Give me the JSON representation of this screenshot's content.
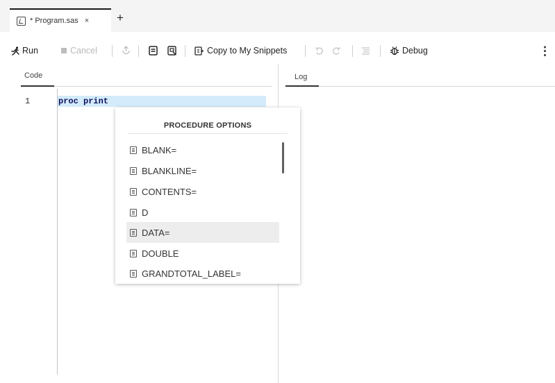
{
  "tabs": [
    {
      "label": "* Program.sas",
      "close": "×"
    }
  ],
  "add_tab": "+",
  "toolbar": {
    "run": "Run",
    "cancel": "Cancel",
    "copy_snippets": "Copy to My Snippets",
    "debug": "Debug",
    "more": "⋮"
  },
  "code_panel": {
    "label": "Code"
  },
  "log_panel": {
    "label": "Log"
  },
  "editor": {
    "lines": [
      {
        "number": "1",
        "text": "proc print"
      }
    ]
  },
  "autocomplete": {
    "header": "PROCEDURE OPTIONS",
    "items": [
      {
        "label": "BLANK="
      },
      {
        "label": "BLANKLINE="
      },
      {
        "label": "CONTENTS="
      },
      {
        "label": "D"
      },
      {
        "label": "DATA=",
        "highlighted": true
      },
      {
        "label": "DOUBLE"
      },
      {
        "label": "GRANDTOTAL_LABEL="
      }
    ]
  },
  "colors": {
    "line_highlight": "#d3ebfa",
    "code_keyword": "#10105c",
    "item_highlight": "#ededed"
  }
}
